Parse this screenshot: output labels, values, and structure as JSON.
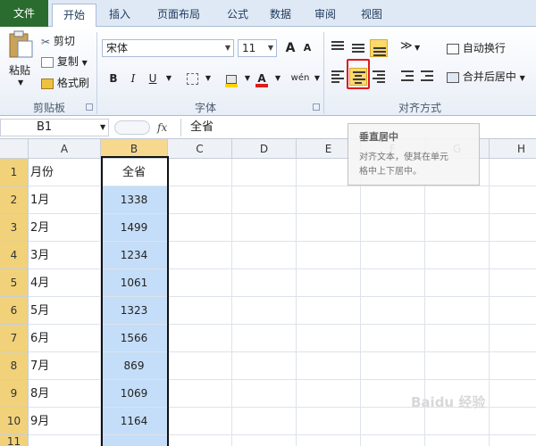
{
  "tabs": [
    "文件",
    "开始",
    "插入",
    "页面布局",
    "公式",
    "数据",
    "审阅",
    "视图"
  ],
  "clipboard": {
    "paste_label": "粘贴",
    "cut_label": "剪切",
    "copy_label": "复制",
    "format_painter_label": "格式刷",
    "group_label": "剪贴板"
  },
  "font": {
    "family": "宋体",
    "size": "11",
    "grow_label": "A",
    "shrink_label": "A",
    "bold": "B",
    "italic": "I",
    "underline": "U",
    "color_label": "A",
    "phonetic_label": "wén",
    "group_label": "字体",
    "accent_red": "#e0191b",
    "fill_yellow": "#ffd400"
  },
  "alignment": {
    "wrap_label": "自动换行",
    "merge_label": "合并后居中",
    "group_label": "对齐方式"
  },
  "formula_bar": {
    "name_box": "B1",
    "fx": "fx",
    "content": "全省"
  },
  "columns": [
    "A",
    "B",
    "C",
    "D",
    "E",
    "F",
    "G",
    "H"
  ],
  "rows": [
    {
      "num": "1",
      "a": "月份",
      "b": "全省"
    },
    {
      "num": "2",
      "a": "1月",
      "b": "1338"
    },
    {
      "num": "3",
      "a": "2月",
      "b": "1499"
    },
    {
      "num": "4",
      "a": "3月",
      "b": "1234"
    },
    {
      "num": "5",
      "a": "4月",
      "b": "1061"
    },
    {
      "num": "6",
      "a": "5月",
      "b": "1323"
    },
    {
      "num": "7",
      "a": "6月",
      "b": "1566"
    },
    {
      "num": "8",
      "a": "7月",
      "b": "869"
    },
    {
      "num": "9",
      "a": "8月",
      "b": "1069"
    },
    {
      "num": "10",
      "a": "9月",
      "b": "1164"
    },
    {
      "num": "11",
      "a": "",
      "b": ""
    }
  ],
  "tooltip": {
    "title": "垂直居中",
    "body_line1": "对齐文本，使其在单元",
    "body_line2": "格中上下居中。"
  },
  "watermark": "Baidu 经验"
}
